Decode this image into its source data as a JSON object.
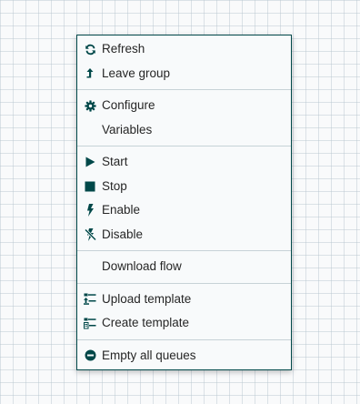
{
  "menu": {
    "items": [
      {
        "label": "Refresh",
        "icon": "refresh-icon"
      },
      {
        "label": "Leave group",
        "icon": "level-up-icon"
      },
      {
        "label": "Configure",
        "icon": "gear-icon"
      },
      {
        "label": "Variables",
        "icon": ""
      },
      {
        "label": "Start",
        "icon": "play-icon"
      },
      {
        "label": "Stop",
        "icon": "stop-icon"
      },
      {
        "label": "Enable",
        "icon": "flash-icon"
      },
      {
        "label": "Disable",
        "icon": "disabled-flash-icon"
      },
      {
        "label": "Download flow",
        "icon": ""
      },
      {
        "label": "Upload template",
        "icon": "upload-template-icon"
      },
      {
        "label": "Create template",
        "icon": "create-template-icon"
      },
      {
        "label": "Empty all queues",
        "icon": "minus-circle-icon"
      }
    ]
  },
  "colors": {
    "icon": "#004849",
    "text": "#262626",
    "border": "#004849",
    "separator": "#c7d2d7"
  }
}
